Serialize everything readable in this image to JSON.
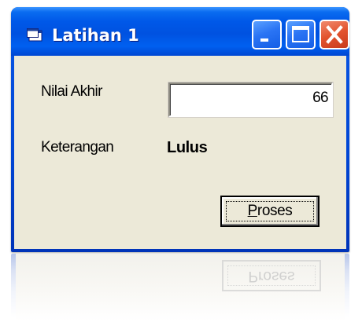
{
  "window": {
    "title": "Latihan 1",
    "icon": "form-window-icon",
    "controls": {
      "minimize_icon": "minimize-icon",
      "maximize_icon": "maximize-icon",
      "close_icon": "close-icon"
    },
    "colors": {
      "title_bar": "#0058e8",
      "client_background": "#ece9d8",
      "close_button": "#e2532e"
    }
  },
  "form": {
    "nilai_label": "Nilai Akhir",
    "nilai_value": "66",
    "keterangan_label": "Keterangan",
    "keterangan_value": "Lulus",
    "button_label_mnemonic": "P",
    "button_label_rest": "roses"
  },
  "reflection": {
    "button_text": "Proses"
  }
}
